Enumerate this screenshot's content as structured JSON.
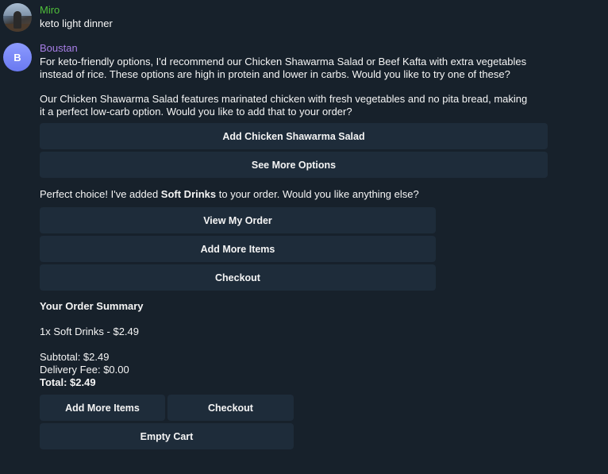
{
  "messages": {
    "user": {
      "name": "Miro",
      "text": "keto light dinner"
    },
    "bot": {
      "name": "Boustan",
      "avatar_letter": "B",
      "paragraph1_line1": "For keto-friendly options, I'd recommend our Chicken Shawarma Salad or Beef Kafta with extra vegetables",
      "paragraph1_line2": "instead of rice. These options are high in protein and lower in carbs. Would you like to try one of these?",
      "paragraph2_line1": "Our Chicken Shawarma Salad features marinated chicken with fresh vegetables and no pita bread, making",
      "paragraph2_line2": "it a perfect low-carb option. Would you like to add that to your order?",
      "buttons1": [
        "Add Chicken Shawarma Salad",
        "See More Options"
      ],
      "added_prefix": "Perfect choice! I've added ",
      "added_item": "Soft Drinks",
      "added_suffix": " to your order. Would you like anything else?",
      "buttons2": [
        "View My Order",
        "Add More Items",
        "Checkout"
      ],
      "summary": {
        "title": "Your Order Summary",
        "line_item": "1x Soft Drinks - $2.49",
        "subtotal": "Subtotal: $2.49",
        "delivery_fee": "Delivery Fee: $0.00",
        "total": "Total: $2.49"
      },
      "buttons3": [
        "Add More Items",
        "Checkout",
        "Empty Cart"
      ]
    }
  },
  "colors": {
    "background": "#17212b",
    "button_bg": "#1e2c3a",
    "user_name": "#4fbf3a",
    "bot_name": "#a77ee6",
    "text": "#f5f5f5"
  }
}
